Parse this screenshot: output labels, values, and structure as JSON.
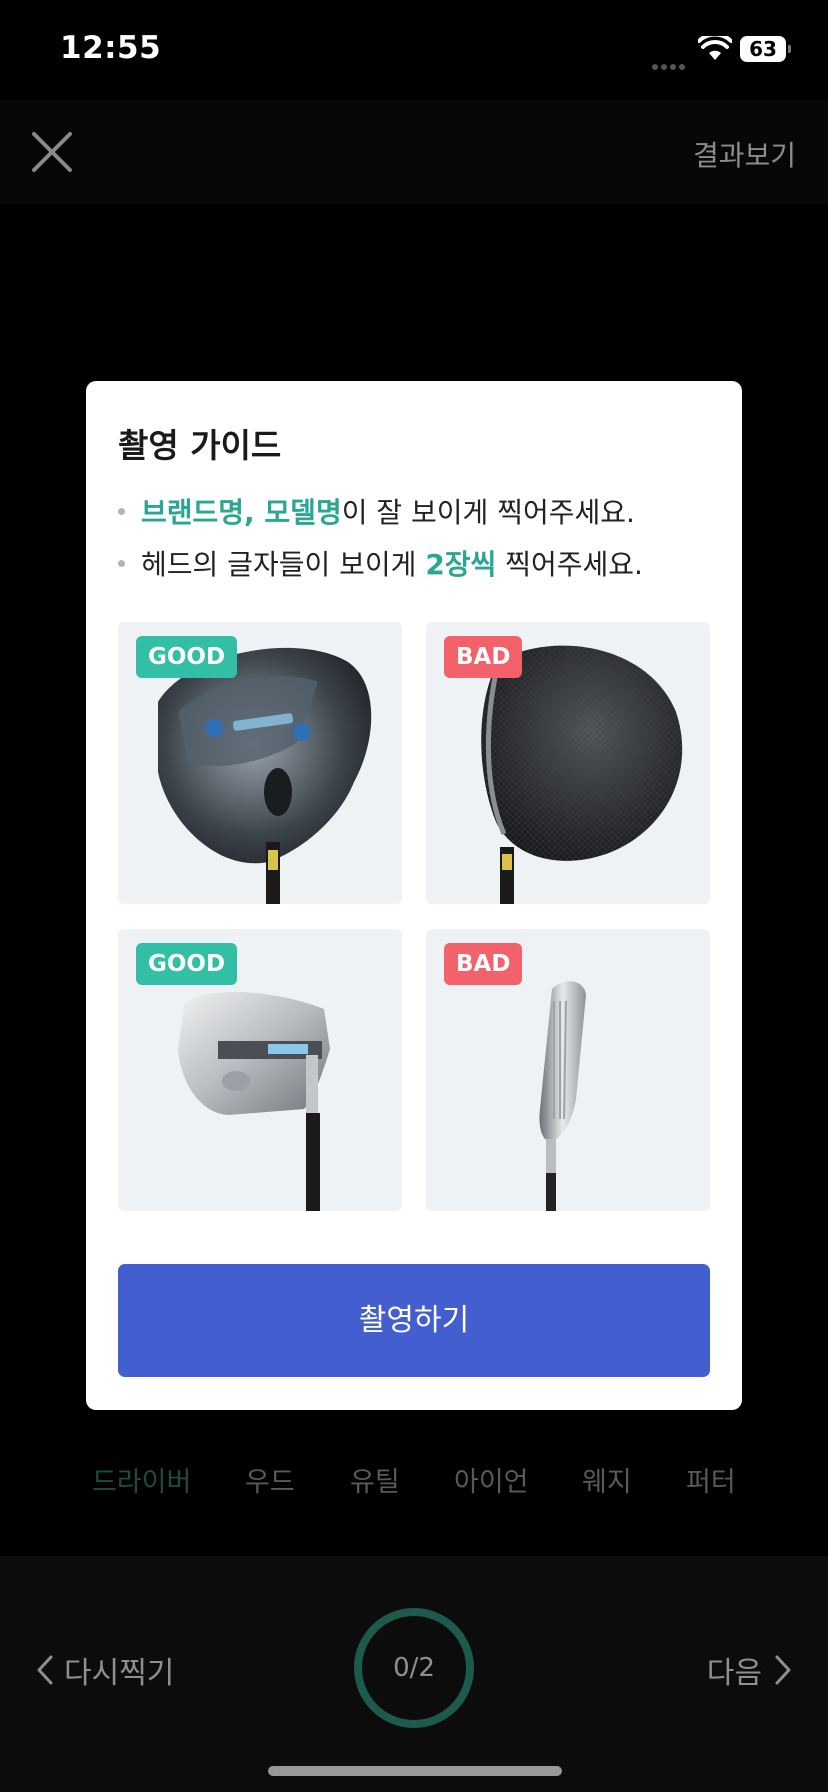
{
  "status_bar": {
    "time": "12:55",
    "battery": "63"
  },
  "top_bar": {
    "result_label": "결과보기"
  },
  "modal": {
    "title": "촬영 가이드",
    "bullet1": {
      "highlight": "브랜드명, 모델명",
      "rest": "이 잘 보이게 찍어주세요."
    },
    "bullet2": {
      "pre": "헤드의 글자들이 보이게 ",
      "highlight": "2장씩",
      "post": " 찍어주세요."
    },
    "cards": [
      {
        "badge": "GOOD",
        "subject": "driver-front"
      },
      {
        "badge": "BAD",
        "subject": "driver-back"
      },
      {
        "badge": "GOOD",
        "subject": "iron-front"
      },
      {
        "badge": "BAD",
        "subject": "iron-side"
      }
    ],
    "shoot_button": "촬영하기"
  },
  "tabs": [
    "드라이버",
    "우드",
    "유틸",
    "아이언",
    "웨지",
    "퍼터"
  ],
  "bottom_bar": {
    "retake_label": "다시찍기",
    "counter": "0/2",
    "next_label": "다음"
  },
  "colors": {
    "accent_green": "#2aa693",
    "good_badge": "#33bea6",
    "bad_badge": "#f3616b",
    "primary_button": "#425ecf"
  }
}
